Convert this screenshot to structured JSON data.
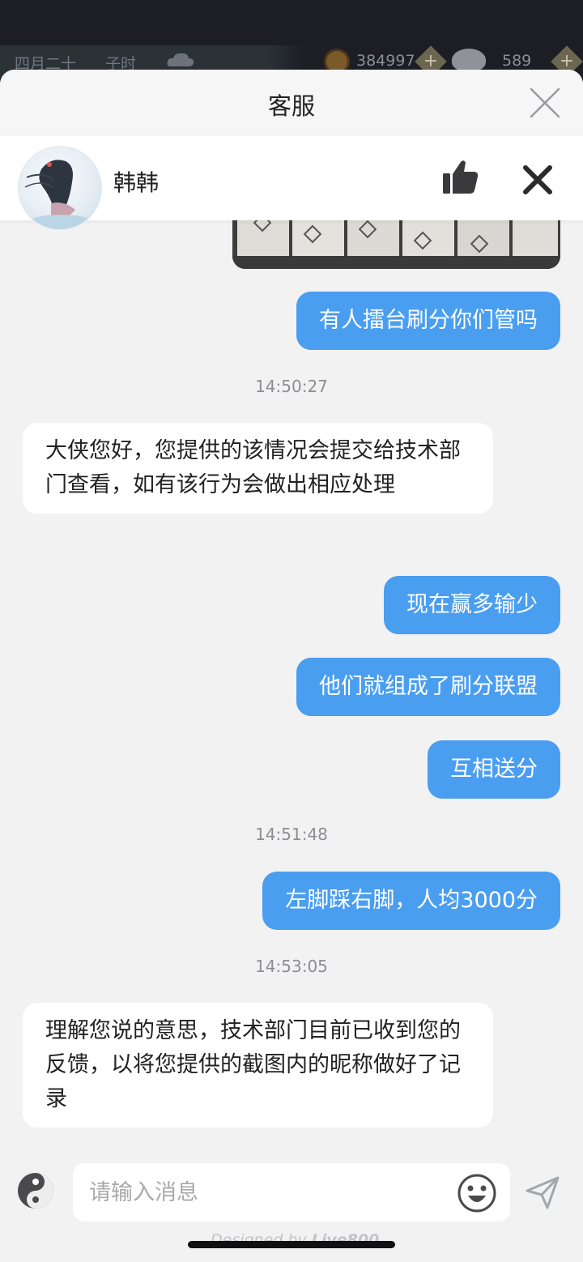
{
  "game_status": {
    "date": "四月二十",
    "hour": "子时",
    "coins": "384997",
    "ingots": "589",
    "plus_symbol": "+"
  },
  "header": {
    "title": "客服"
  },
  "agent": {
    "name": "韩韩"
  },
  "messages": [
    {
      "type": "image",
      "from": "user"
    },
    {
      "type": "text",
      "from": "user",
      "text": "有人擂台刷分你们管吗"
    },
    {
      "type": "time",
      "text": "14:50:27"
    },
    {
      "type": "text",
      "from": "agent",
      "text": "大侠您好，您提供的该情况会提交给技术部门查看，如有该行为会做出相应处理"
    },
    {
      "type": "text",
      "from": "user",
      "text": "现在赢多输少"
    },
    {
      "type": "text",
      "from": "user",
      "text": "他们就组成了刷分联盟"
    },
    {
      "type": "text",
      "from": "user",
      "text": "互相送分"
    },
    {
      "type": "time",
      "text": "14:51:48"
    },
    {
      "type": "text",
      "from": "user",
      "text": "左脚踩右脚，人均3000分"
    },
    {
      "type": "time",
      "text": "14:53:05"
    },
    {
      "type": "text",
      "from": "agent",
      "text": "理解您说的意思，技术部门目前已收到您的反馈，以将您提供的截图内的昵称做好了记录"
    }
  ],
  "input": {
    "placeholder": "请输入消息",
    "value": ""
  },
  "footer": {
    "powered_prefix": "Designed by",
    "powered_brand": "Live800"
  },
  "colors": {
    "user_bubble": "#4a9ef0",
    "agent_bubble": "#ffffff",
    "background": "#f2f2f3"
  }
}
